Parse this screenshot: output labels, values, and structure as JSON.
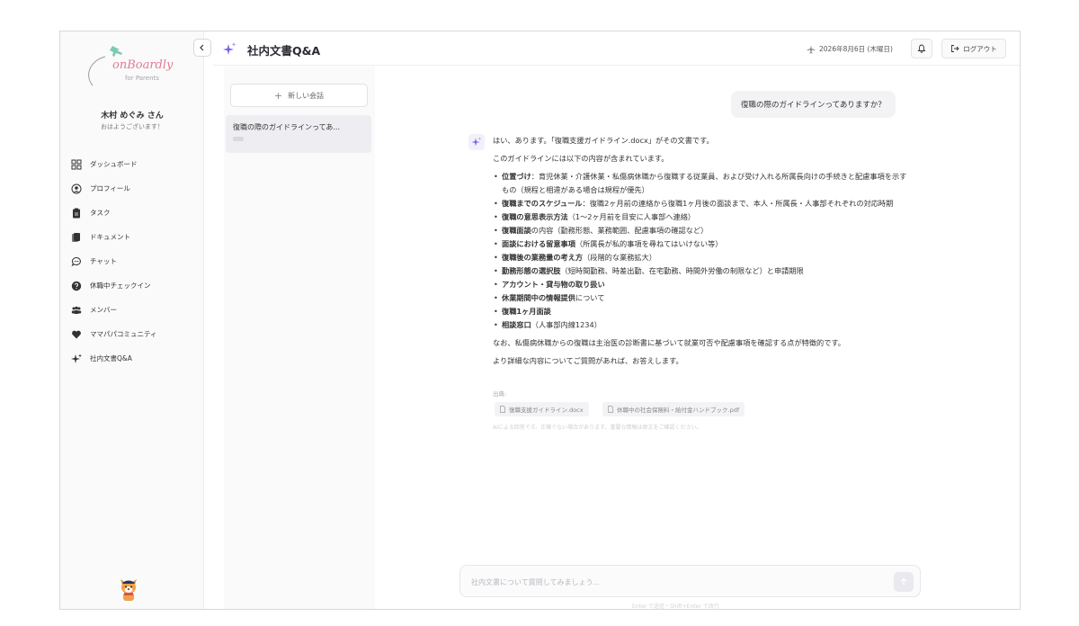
{
  "brand": {
    "logo_text": "onBoardly",
    "logo_subtitle": "for Parents",
    "accent_color": "#e37a92",
    "ai_color": "#7b61e8"
  },
  "user": {
    "name": "木村 めぐみ さん",
    "greeting": "おはようございます！"
  },
  "sidebar": {
    "collapse_icon": "chevron-left-icon",
    "items": [
      {
        "label": "ダッシュボード",
        "icon": "grid-icon"
      },
      {
        "label": "プロフィール",
        "icon": "user-circle-icon"
      },
      {
        "label": "タスク",
        "icon": "clipboard-icon"
      },
      {
        "label": "ドキュメント",
        "icon": "document-icon"
      },
      {
        "label": "チャット",
        "icon": "chat-bubble-icon"
      },
      {
        "label": "休職中チェックイン",
        "icon": "question-circle-icon"
      },
      {
        "label": "メンバー",
        "icon": "users-icon"
      },
      {
        "label": "ママパパコミュニティ",
        "icon": "heart-icon"
      },
      {
        "label": "社内文書Q&A",
        "icon": "sparkles-icon"
      }
    ]
  },
  "header": {
    "title": "社内文書Q&A",
    "date": "2026年8月6日 (木曜日)",
    "logout_label": "ログアウト"
  },
  "conversations": {
    "new_label": "新しい会話",
    "items": [
      {
        "title": "復職の際のガイドラインってあ..."
      }
    ]
  },
  "chat": {
    "user_message": "復職の際のガイドラインってありますか？",
    "answer_intro": "はい、あります。「復職支援ガイドライン.docx」がその文書です。",
    "answer_lead": "このガイドラインには以下の内容が含まれています。",
    "bullets": [
      {
        "bold": "位置づけ",
        "text": "：育児休業・介護休業・私傷病休職から復職する従業員、および受け入れる所属長向けの手続きと配慮事項を示すもの（規程と相違がある場合は規程が優先）"
      },
      {
        "bold": "復職までのスケジュール",
        "text": "：復職2ヶ月前の連絡から復職1ヶ月後の面談まで、本人・所属長・人事部それぞれの対応時期"
      },
      {
        "bold": "復職の意思表示方法",
        "text": "（1〜2ヶ月前を目安に人事部へ連絡）"
      },
      {
        "bold": "復職面談",
        "text": "の内容（勤務形態、業務範囲、配慮事項の確認など）"
      },
      {
        "bold": "面談における留意事項",
        "text": "（所属長が私的事項を尋ねてはいけない等）"
      },
      {
        "bold": "復職後の業務量の考え方",
        "text": "（段階的な業務拡大）"
      },
      {
        "bold": "勤務形態の選択肢",
        "text": "（短時間勤務、時差出勤、在宅勤務、時間外労働の制限など）と申請期限"
      },
      {
        "bold": "アカウント・貸与物の取り扱い",
        "text": ""
      },
      {
        "bold": "休業期間中の情報提供",
        "text": "について"
      },
      {
        "bold": "復職1ヶ月面談",
        "text": ""
      },
      {
        "bold": "相談窓口",
        "text": "（人事部内線1234）"
      }
    ],
    "answer_note": "なお、私傷病休職からの復職は主治医の診断書に基づいて就業可否や配慮事項を確認する点が特徴的です。",
    "answer_closing": "より詳細な内容についてご質問があれば、お答えします。",
    "sources_label": "出典:",
    "sources": [
      "復職支援ガイドライン.docx",
      "休職中の社会保険料・給付金ハンドブック.pdf"
    ],
    "disclaimer": "AIによる回答です。正確でない場合があります。重要な情報は原文をご確認ください。"
  },
  "input": {
    "placeholder": "社内文書について質問してみましょう..."
  },
  "footer": {
    "note": "Enter で送信・Shift+Enter で改行"
  }
}
